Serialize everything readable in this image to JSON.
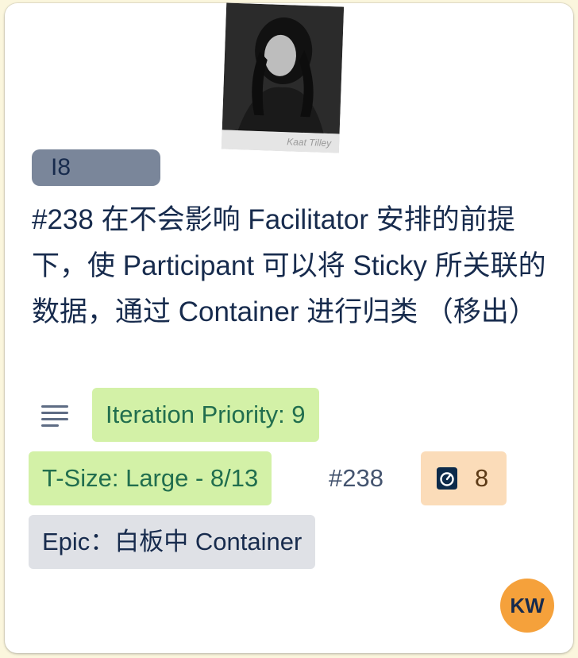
{
  "card": {
    "photo_caption": "Kaat Tilley",
    "label": "I8",
    "title": "#238 在不会影响 Facilitator 安排的前提下，使 Participant 可以将 Sticky 所关联的数据，通过 Container 进行归类 （移出）",
    "badges": {
      "iteration_priority": "Iteration Priority: 9",
      "t_size": "T-Size: Large - 8/13",
      "ref": "#238",
      "story_points": "8",
      "epic": "Epic：白板中 Container"
    },
    "assignee_initials": "KW",
    "colors": {
      "label": "#7a869a",
      "green_badge": "#d3f1a7",
      "points_badge": "#fbdcb9",
      "epic_badge": "#dfe1e6",
      "avatar": "#f5a13b"
    },
    "icons": [
      "description-icon",
      "story-points-icon"
    ]
  }
}
